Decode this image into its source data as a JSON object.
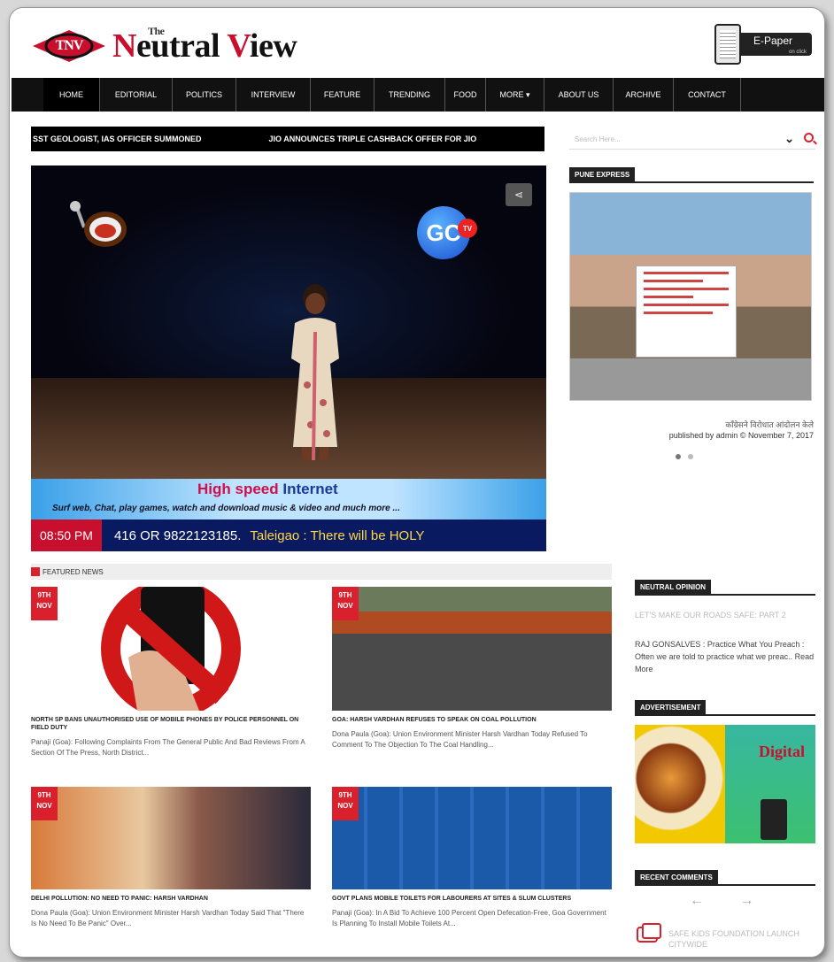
{
  "header": {
    "logo_badge": "TNV",
    "logo_the": "The",
    "logo_name_n": "N",
    "logo_name_1": "eutral ",
    "logo_name_v": "V",
    "logo_name_2": "iew",
    "epaper": "E-Paper",
    "epaper_sub": "on click"
  },
  "nav": [
    "HOME",
    "EDITORIAL",
    "POLITICS",
    "INTERVIEW",
    "FEATURE",
    "TRENDING",
    "FOOD",
    "MORE ▾",
    "ABOUT US",
    "ARCHIVE",
    "CONTACT"
  ],
  "ticker": [
    "SST GEOLOGIST, IAS OFFICER SUMMONED",
    "JIO ANNOUNCES TRIPLE CASHBACK OFFER FOR JIO"
  ],
  "search": {
    "placeholder": "Search Here..."
  },
  "video": {
    "banner_h1": "High speed ",
    "banner_h2": "Internet",
    "banner_sub": "Surf web, Chat, play games, watch and download music & video and much more ...",
    "time": "08:50 PM",
    "crawl": "416 OR 9822123185.",
    "crawl2": "Taleigao : There will be HOLY"
  },
  "sidebar": {
    "pune_label": "PUNE EXPRESS",
    "pune_caption": "काँग्रेसने विरोधात आंदोलन केले",
    "pune_published": "published by admin © November 7, 2017",
    "opinion_label": "NEUTRAL OPINION",
    "opinion_title": "LET'S MAKE OUR ROADS SAFE: PART 2",
    "opinion_text": "RAJ GONSALVES : Practice What You Preach : Often we are told to practice what we preac.. Read More",
    "ad_label": "ADVERTISEMENT",
    "ad_brand": "Digital",
    "rc_label": "RECENT COMMENTS",
    "rc_arrows": "← →",
    "rc_text": "SAFE KIDS FOUNDATION LAUNCH CITYWIDE"
  },
  "featured": {
    "label": "FEATURED NEWS",
    "cards": [
      {
        "date1": "9TH",
        "date2": "NOV",
        "title": "NORTH SP BANS UNAUTHORISED USE OF MOBILE PHONES BY POLICE PERSONNEL ON FIELD DUTY",
        "text": "Panaji (Goa): Following Complaints From The General Public And Bad Reviews From A Section Of The Press, North District..."
      },
      {
        "date1": "9TH",
        "date2": "NOV",
        "title": "GOA: HARSH VARDHAN REFUSES TO SPEAK ON COAL POLLUTION",
        "text": "Dona Paula (Goa): Union Environment Minister Harsh Vardhan Today Refused To Comment To The Objection To The Coal Handling..."
      },
      {
        "date1": "9TH",
        "date2": "NOV",
        "title": "DELHI POLLUTION: NO NEED TO PANIC: HARSH VARDHAN",
        "text": "Dona Paula (Goa): Union Environment Minister Harsh Vardhan Today Said That \"There Is No Need To Be Panic\" Over..."
      },
      {
        "date1": "9TH",
        "date2": "NOV",
        "title": "GOVT PLANS MOBILE TOILETS FOR LABOURERS AT SITES & SLUM CLUSTERS",
        "text": "Panaji (Goa): In A Bid To Achieve 100 Percent Open Defecation-Free, Goa Government Is Planning To Install Mobile Toilets At..."
      }
    ]
  }
}
